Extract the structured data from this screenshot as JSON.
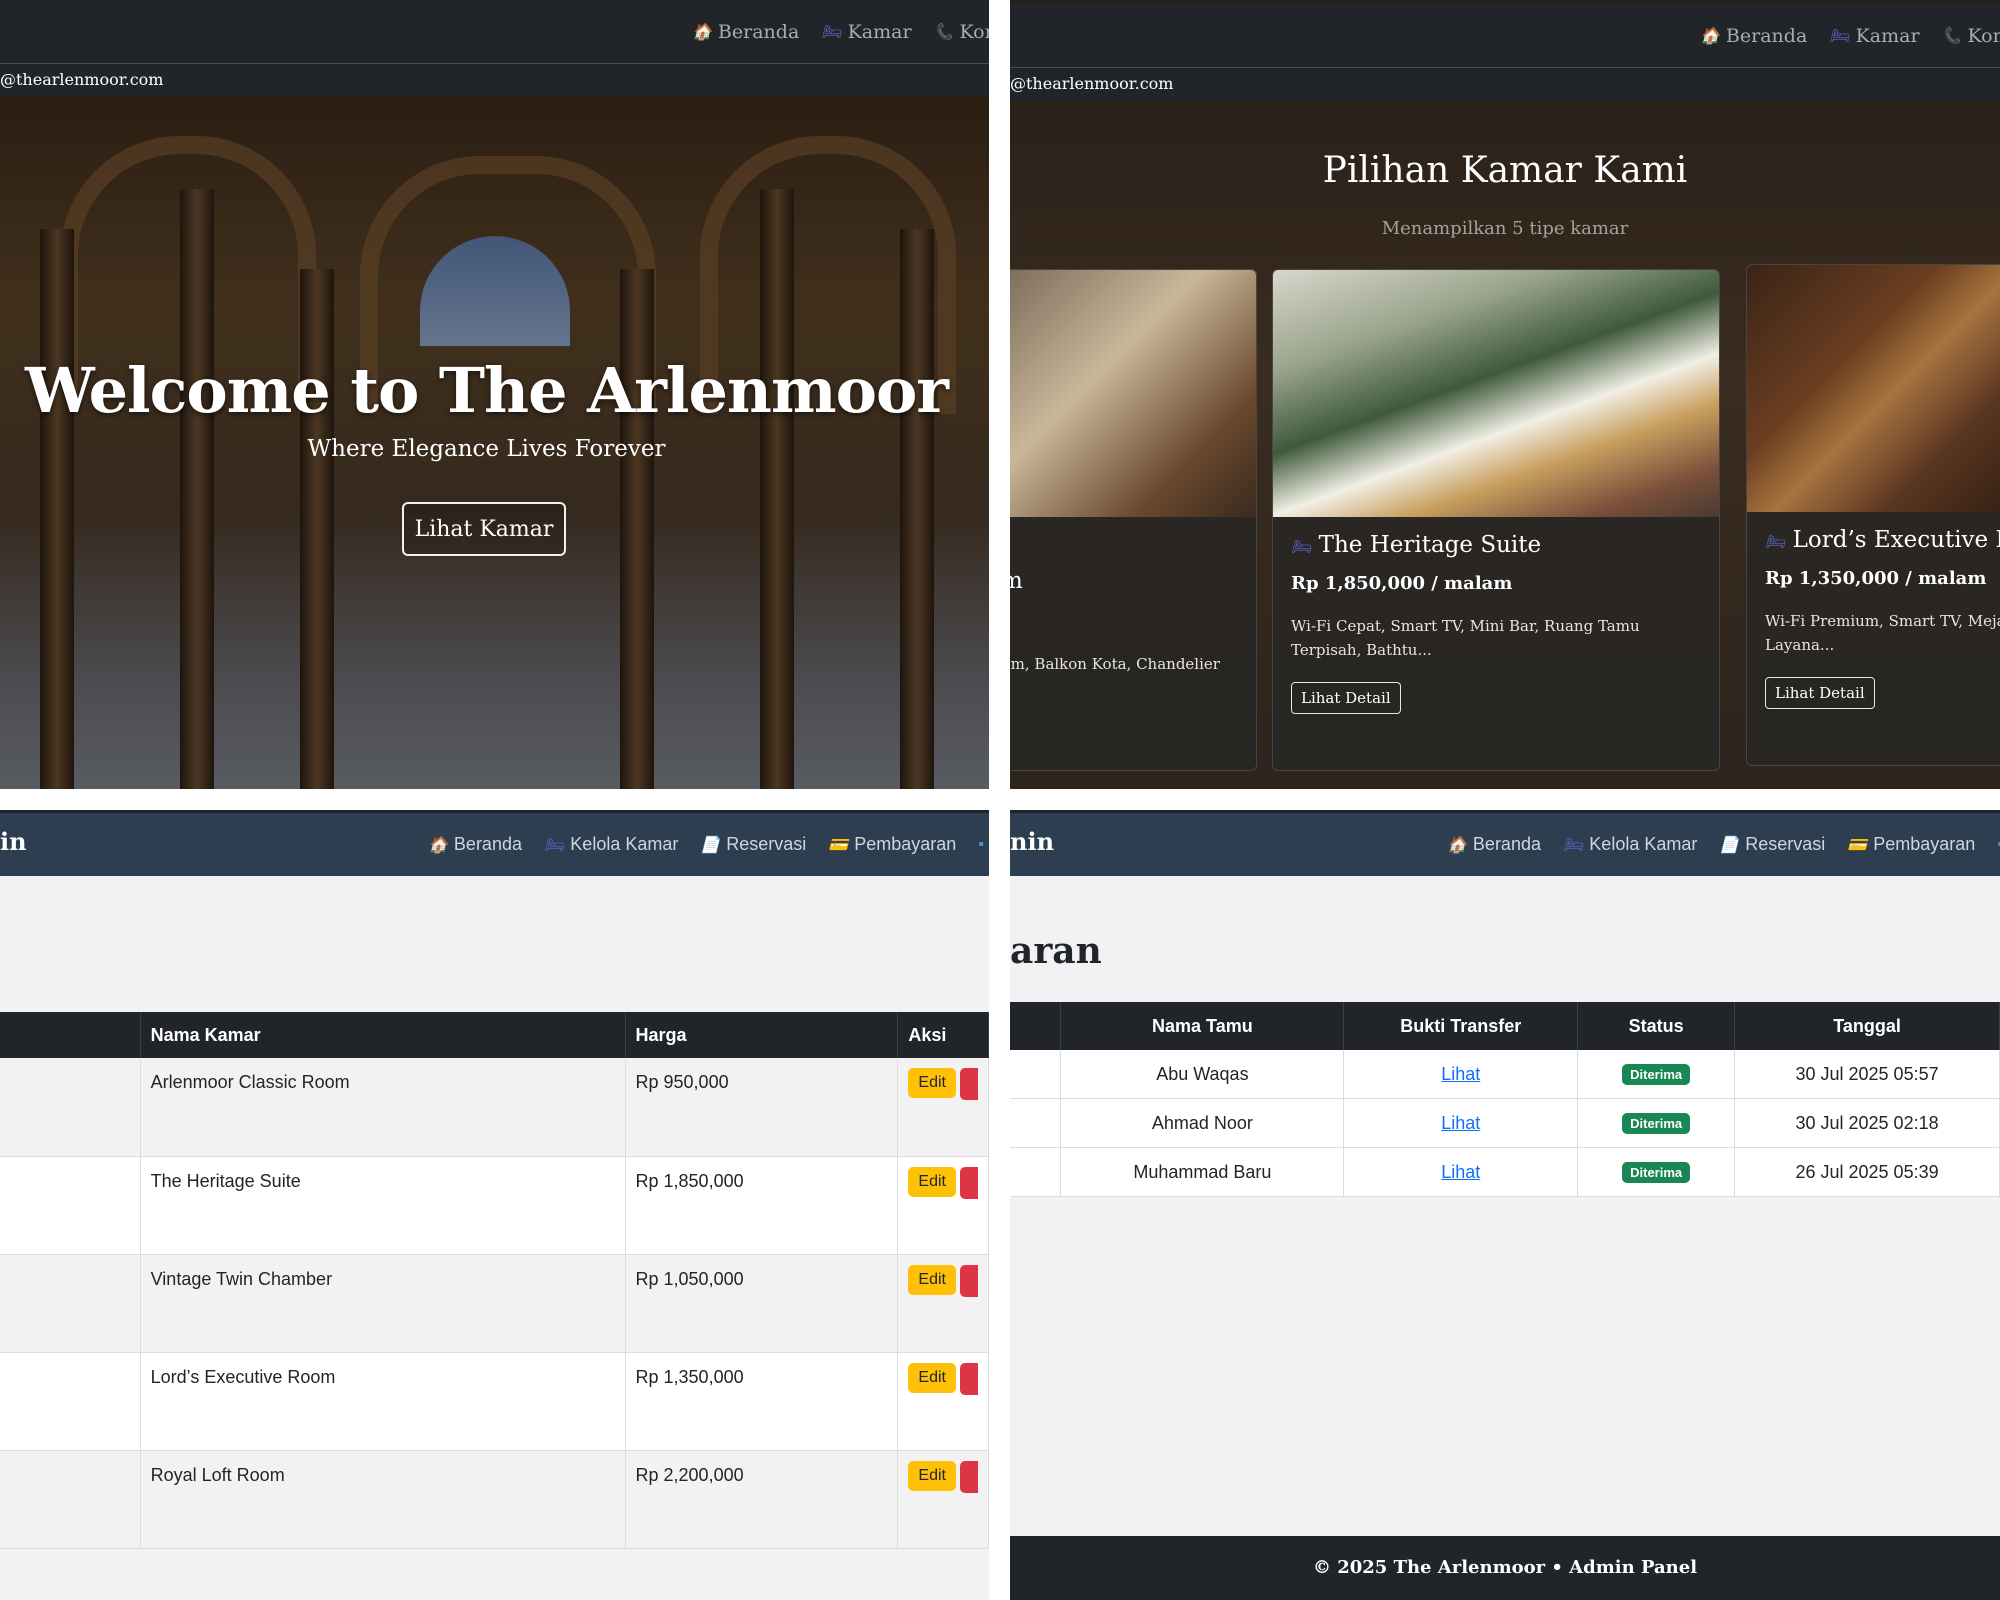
{
  "hero_panel": {
    "nav": [
      {
        "icon": "house-icon",
        "label": "Beranda"
      },
      {
        "icon": "bed-icon",
        "label": "Kamar"
      },
      {
        "icon": "phone-icon",
        "label": "Konta"
      }
    ],
    "email": "@thearlenmoor.com",
    "title": "Welcome to The Arlenmoor",
    "subtitle": "Where Elegance Lives Forever",
    "button": "Lihat Kamar"
  },
  "rooms_panel": {
    "nav": [
      {
        "icon": "house-icon",
        "label": "Beranda"
      },
      {
        "icon": "bed-icon",
        "label": "Kamar"
      },
      {
        "icon": "phone-icon",
        "label": "Kontak"
      }
    ],
    "email": "@thearlenmoor.com",
    "title": "Pilihan Kamar Kami",
    "subtitle": "Menampilkan 5 tipe kamar",
    "cards": [
      {
        "name": "m",
        "price": "",
        "facilities": "um, Balkon Kota, Chandelier",
        "button": ""
      },
      {
        "name": "The Heritage Suite",
        "price": "Rp 1,850,000 / malam",
        "facilities": "Wi-Fi Cepat, Smart TV, Mini Bar, Ruang Tamu Terpisah, Bathtu...",
        "button": "Lihat Detail"
      },
      {
        "name": "Lord’s Executive Ro",
        "price": "Rp 1,350,000 / malam",
        "facilities": "Wi-Fi Premium, Smart TV, Meja Layana...",
        "button": "Lihat Detail"
      }
    ]
  },
  "admin_rooms_panel": {
    "brand": "in",
    "nav": [
      {
        "icon": "house-icon",
        "label": "Beranda"
      },
      {
        "icon": "bed-icon",
        "label": "Kelola Kamar"
      },
      {
        "icon": "memo-icon",
        "label": "Reservasi"
      },
      {
        "icon": "card-icon",
        "label": "Pembayaran"
      }
    ],
    "columns": [
      "Nama Kamar",
      "Harga",
      "Aksi"
    ],
    "rows": [
      {
        "name": "Arlenmoor Classic Room",
        "price": "Rp 950,000",
        "edit": "Edit"
      },
      {
        "name": "The Heritage Suite",
        "price": "Rp 1,850,000",
        "edit": "Edit"
      },
      {
        "name": "Vintage Twin Chamber",
        "price": "Rp 1,050,000",
        "edit": "Edit"
      },
      {
        "name": "Lord’s Executive Room",
        "price": "Rp 1,350,000",
        "edit": "Edit"
      },
      {
        "name": "Royal Loft Room",
        "price": "Rp 2,200,000",
        "edit": "Edit"
      }
    ]
  },
  "payments_panel": {
    "brand": "nin",
    "nav": [
      {
        "icon": "house-icon",
        "label": "Beranda"
      },
      {
        "icon": "bed-icon",
        "label": "Kelola Kamar"
      },
      {
        "icon": "memo-icon",
        "label": "Reservasi"
      },
      {
        "icon": "card-icon",
        "label": "Pembayaran"
      }
    ],
    "title": "aran",
    "columns": [
      "Nama Tamu",
      "Bukti Transfer",
      "Status",
      "Tanggal"
    ],
    "rows": [
      {
        "guest": "Abu Waqas",
        "proof": "Lihat",
        "status": "Diterima",
        "date": "30 Jul 2025 05:57"
      },
      {
        "guest": "Ahmad Noor",
        "proof": "Lihat",
        "status": "Diterima",
        "date": "30 Jul 2025 02:18"
      },
      {
        "guest": "Muhammad Baru",
        "proof": "Lihat",
        "status": "Diterima",
        "date": "26 Jul 2025 05:39"
      }
    ],
    "footer": "© 2025 The Arlenmoor • Admin Panel"
  },
  "colors": {
    "dark": "#212529",
    "admin_nav": "#2c3e50",
    "edit": "#ffc107",
    "delete": "#dc3545",
    "badge": "#198754",
    "link": "#0d6efd"
  }
}
